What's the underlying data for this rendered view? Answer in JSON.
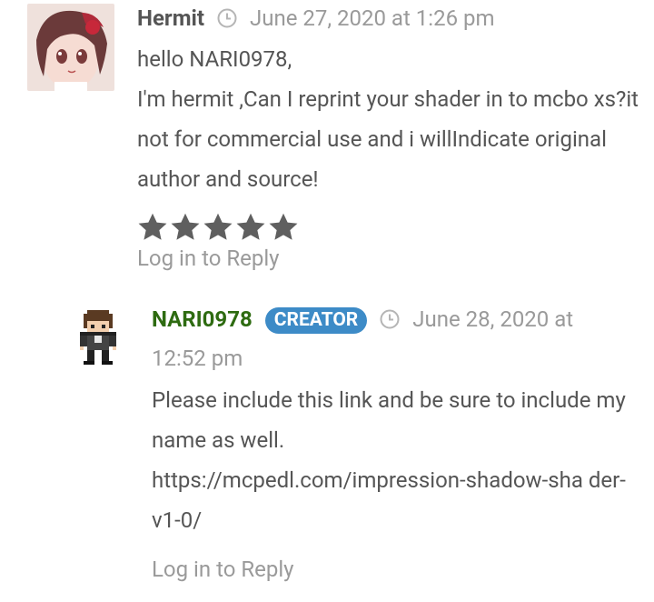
{
  "comments": [
    {
      "author": "Hermit",
      "date": "June 27, 2020 at 1:26 pm",
      "body": [
        "hello NARI0978,",
        "I'm hermit ,Can I reprint your shader in to mcbo xs?it not for commercial use and i willIndicate original author and source!"
      ],
      "rating": 5,
      "reply_label": "Log in to Reply"
    },
    {
      "author": "NARI0978",
      "badge": "CREATOR",
      "date_part1": "June 28, 2020 at",
      "date_part2": "12:52 pm",
      "body": [
        "Please include this link and be sure to include my name as well.",
        "https://mcpedl.com/impression-shadow-sha der-v1-0/"
      ],
      "reply_label": "Log in to Reply"
    }
  ],
  "colors": {
    "creator_badge": "#3d8bc7",
    "creator_name": "#2e6b11",
    "muted": "#9a9a9a",
    "text": "#555555",
    "star": "#5f5f5f"
  },
  "icons": {
    "clock": "clock-icon",
    "star": "star-icon"
  }
}
